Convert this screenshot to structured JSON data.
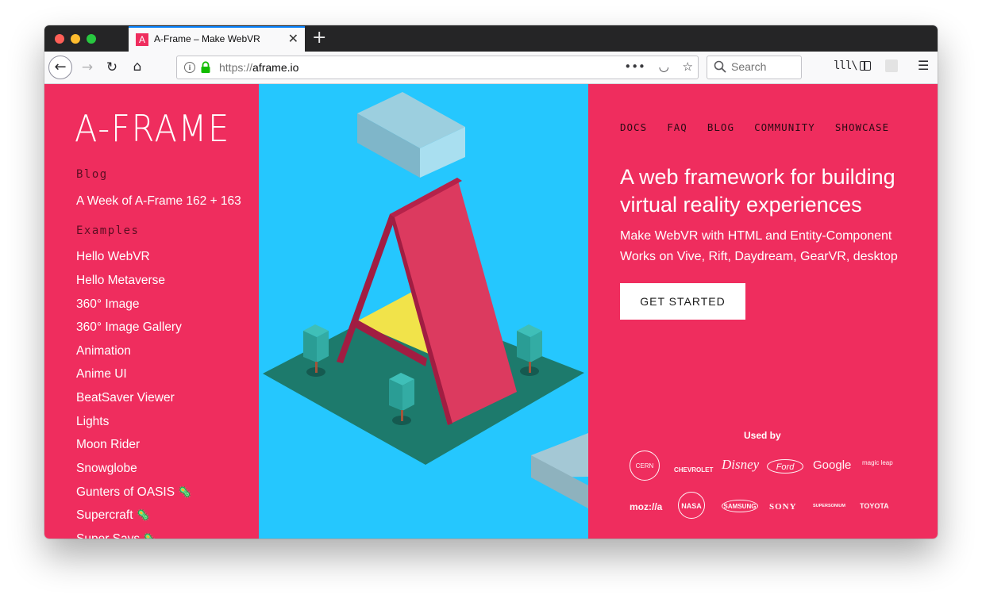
{
  "browser": {
    "tab_title": "A-Frame – Make WebVR",
    "tab_favicon_letter": "A",
    "url_scheme": "https://",
    "url_host": "aframe.io",
    "search_placeholder": "Search",
    "icons": {
      "back": "←",
      "forward": "→",
      "reload": "↻",
      "home": "⌂",
      "page_actions": "•••",
      "pocket": "◡",
      "bookmark": "☆",
      "library": "lll\\",
      "menu": "☰",
      "close": "✕",
      "new_tab": "+"
    }
  },
  "sidebar": {
    "logo": "A-FRAME",
    "blog_heading": "Blog",
    "blog_post": "A Week of A-Frame 162 + 163",
    "examples_heading": "Examples",
    "examples": [
      "Hello WebVR",
      "Hello Metaverse",
      "360° Image",
      "360° Image Gallery",
      "Animation",
      "Anime UI",
      "BeatSaver Viewer",
      "Lights",
      "Moon Rider",
      "Snowglobe",
      "Gunters of OASIS",
      "Supercraft",
      "Super Says"
    ],
    "example_emoji": "🦠"
  },
  "nav": [
    "DOCS",
    "FAQ",
    "BLOG",
    "COMMUNITY",
    "SHOWCASE"
  ],
  "hero": {
    "headline": "A web framework for building virtual reality experiences",
    "sub1": "Make WebVR with HTML and Entity-Component",
    "sub2": "Works on Vive, Rift, Daydream, GearVR, desktop",
    "cta": "GET STARTED"
  },
  "used_by": {
    "label": "Used by",
    "brands": [
      "CERN",
      "CHEVROLET",
      "Disney",
      "Ford",
      "Google",
      "magic leap",
      "moz://a",
      "NASA",
      "SAMSUNG",
      "SONY",
      "SUPERSONIUM",
      "TOYOTA"
    ]
  },
  "colors": {
    "brand_pink": "#ef2d5e",
    "hero_blue": "#25c7fe",
    "tab_accent": "#0a84ff"
  }
}
